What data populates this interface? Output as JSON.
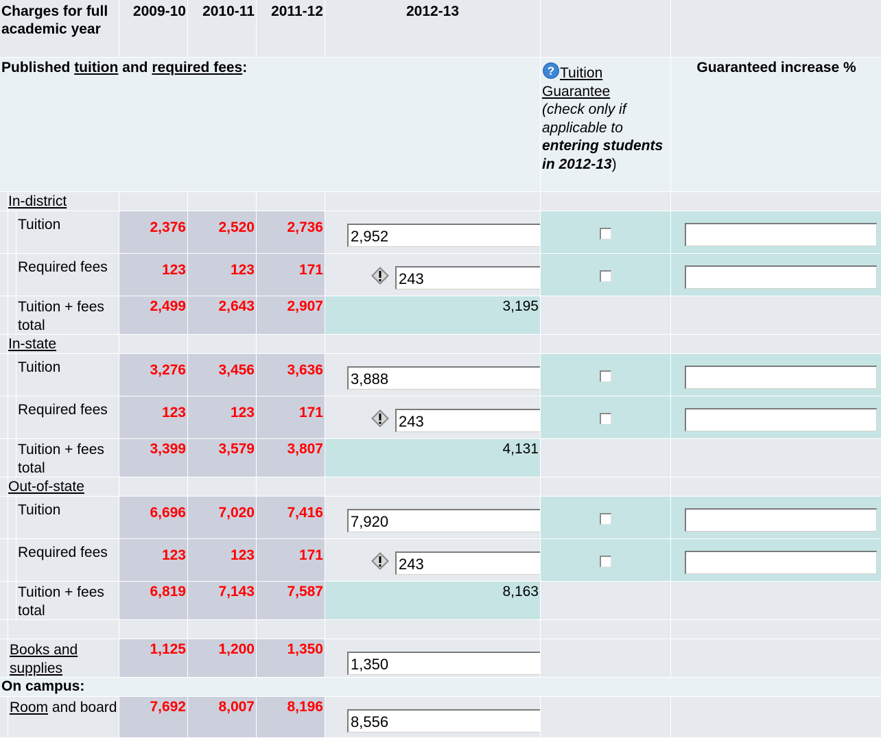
{
  "header": {
    "charges_label": "Charges for full academic year",
    "years": [
      "2009-10",
      "2010-11",
      "2011-12",
      "2012-13"
    ],
    "published_prefix": "Published ",
    "tuition_link": "tuition",
    "and_text": " and ",
    "required_fees_link": "required fees",
    "colon": ":",
    "guarantee_link": "Tuition Guarantee",
    "guarantee_note_1": "(check only if applicable to ",
    "guarantee_note_bold": "entering students in 2012-13",
    "guarantee_note_2": ")",
    "guaranteed_increase": "Guaranteed increase %"
  },
  "sections": [
    {
      "name": "In-district",
      "rows": [
        {
          "label": "Tuition",
          "v": [
            "2,376",
            "2,520",
            "2,736"
          ],
          "input": "2,952",
          "has_check": true
        },
        {
          "label": "Required fees",
          "v": [
            "123",
            "123",
            "171"
          ],
          "input": "243",
          "has_check": true,
          "warning": true
        },
        {
          "label": "Tuition + fees total",
          "v": [
            "2,499",
            "2,643",
            "2,907"
          ],
          "total": "3,195"
        }
      ]
    },
    {
      "name": "In-state",
      "rows": [
        {
          "label": "Tuition",
          "v": [
            "3,276",
            "3,456",
            "3,636"
          ],
          "input": "3,888",
          "has_check": true
        },
        {
          "label": "Required fees",
          "v": [
            "123",
            "123",
            "171"
          ],
          "input": "243",
          "has_check": true,
          "warning": true
        },
        {
          "label": "Tuition + fees total",
          "v": [
            "3,399",
            "3,579",
            "3,807"
          ],
          "total": "4,131"
        }
      ]
    },
    {
      "name": "Out-of-state",
      "rows": [
        {
          "label": "Tuition",
          "v": [
            "6,696",
            "7,020",
            "7,416"
          ],
          "input": "7,920",
          "has_check": true
        },
        {
          "label": "Required fees",
          "v": [
            "123",
            "123",
            "171"
          ],
          "input": "243",
          "has_check": true,
          "warning": true
        },
        {
          "label": "Tuition + fees total",
          "v": [
            "6,819",
            "7,143",
            "7,587"
          ],
          "total": "8,163"
        }
      ]
    }
  ],
  "books": {
    "label": "Books and supplies",
    "v": [
      "1,125",
      "1,200",
      "1,350"
    ],
    "input": "1,350"
  },
  "on_campus_label": "On campus:",
  "room": {
    "label_link": "Room",
    "label_rest": " and board",
    "v": [
      "7,692",
      "8,007",
      "8,196"
    ],
    "input": "8,556"
  },
  "colors": {
    "value_red": "#ff0000",
    "grey_cell": "#ccd0dc",
    "teal_cell": "#c6e4e4",
    "light_cell": "#e6eaee"
  },
  "icons": {
    "help": "question-circle-icon",
    "warning": "warning-diamond-icon"
  }
}
